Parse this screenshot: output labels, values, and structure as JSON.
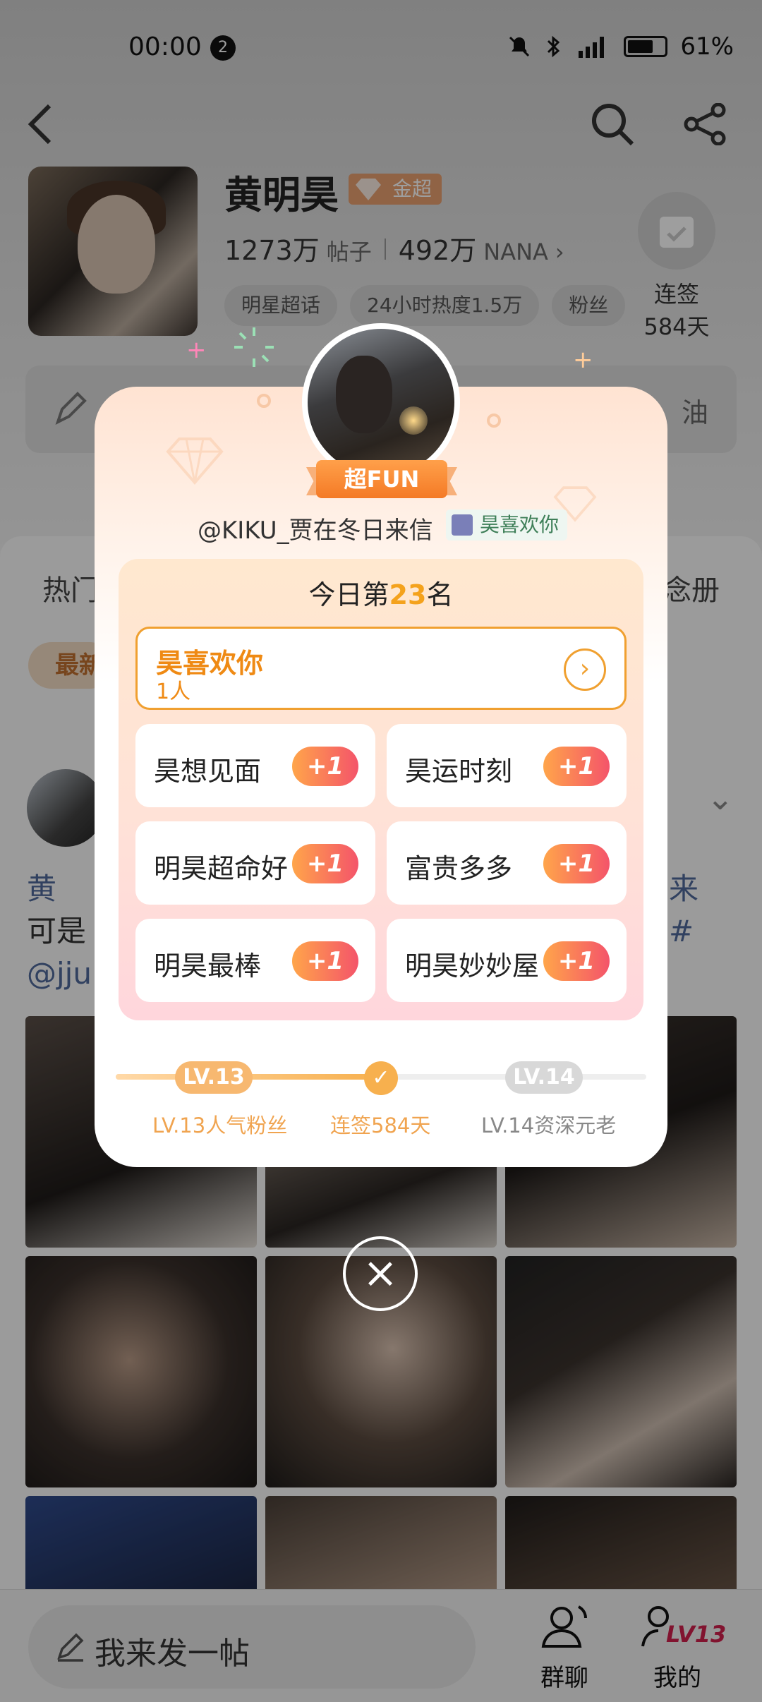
{
  "status": {
    "time": "00:00",
    "notif_count": "2",
    "battery": "61%"
  },
  "header": {
    "star_name": "黄明昊",
    "badge": "金超",
    "posts_num": "1273万",
    "posts_label": "帖子",
    "fans_num": "492万",
    "fans_label": "NANA",
    "chips": [
      "明星超话",
      "24小时热度1.5万",
      "粉丝"
    ],
    "checkin_label": "连签",
    "checkin_days": "584天",
    "bar_text": "油"
  },
  "content": {
    "tab_left": "热门",
    "tab_right": "念册",
    "latest_pill": "最新",
    "post_line1": "黄",
    "post_line1_tail": "来#",
    "post_line2": "可是",
    "post_line3": "@jju"
  },
  "modal": {
    "fun_badge": "超FUN",
    "username": "@KIKU_贾在冬日来信",
    "user_badge": "昊喜欢你",
    "rank_prefix": "今日第",
    "rank_num": "23",
    "rank_suffix": "名",
    "selected": {
      "name": "昊喜欢你",
      "count": "1人"
    },
    "options": [
      {
        "label": "昊想见面",
        "plus": "+1"
      },
      {
        "label": "昊运时刻",
        "plus": "+1"
      },
      {
        "label": "明昊超命好",
        "plus": "+1"
      },
      {
        "label": "富贵多多",
        "plus": "+1"
      },
      {
        "label": "明昊最棒",
        "plus": "+1"
      },
      {
        "label": "明昊妙妙屋",
        "plus": "+1"
      }
    ],
    "progress": {
      "level_current": "LV.13",
      "level_next": "LV.14",
      "label_current": "LV.13人气粉丝",
      "label_mid": "连签584天",
      "label_next": "LV.14资深元老",
      "fill_fraction": 0.5
    }
  },
  "bottom": {
    "compose": "我来发一帖",
    "nav_group": "群聊",
    "nav_mine": "我的",
    "level_tag": "LV13"
  },
  "colors": {
    "accent": "#f4a21c",
    "orange": "#ef8a14",
    "link": "#506a9b"
  }
}
